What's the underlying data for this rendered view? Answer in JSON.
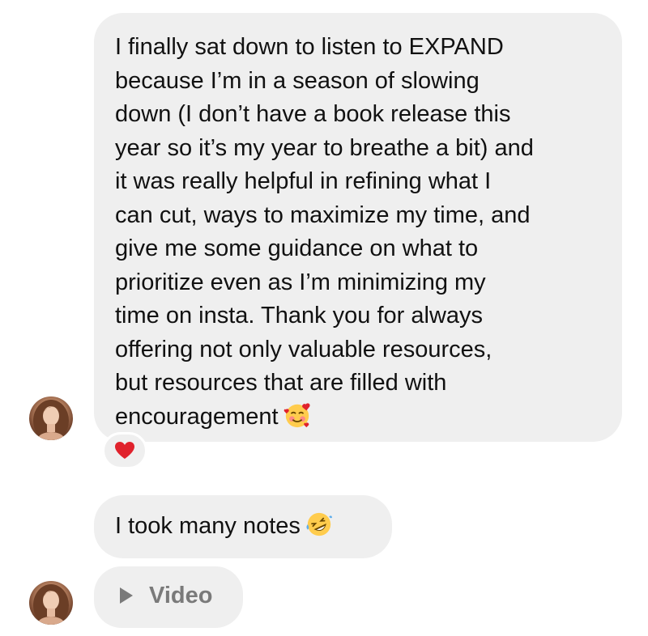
{
  "conversation": {
    "messages": [
      {
        "lines": [
          "I finally sat down to listen to EXPAND",
          "because I’m in a season of slowing",
          "down (I don’t have a book release this",
          "year so it’s my year to breathe a bit) and",
          "it was really helpful in refining what I",
          "can cut, ways to maximize my time, and",
          "give me some guidance on what to",
          "prioritize even as I’m minimizing my",
          "time on insta. Thank you for always",
          "offering not only valuable resources,",
          "but resources that are filled with",
          "encouragement"
        ],
        "emoji": "smiling-face-with-hearts",
        "reaction": "red-heart"
      },
      {
        "text": "I took many notes",
        "emoji": "rolling-on-floor-laughing"
      },
      {
        "text": "Video",
        "icon": "play-icon"
      }
    ]
  },
  "colors": {
    "bubble_bg": "#efefef",
    "text": "#111111",
    "video_label": "#7a7a7a",
    "heart": "#e0222c"
  }
}
